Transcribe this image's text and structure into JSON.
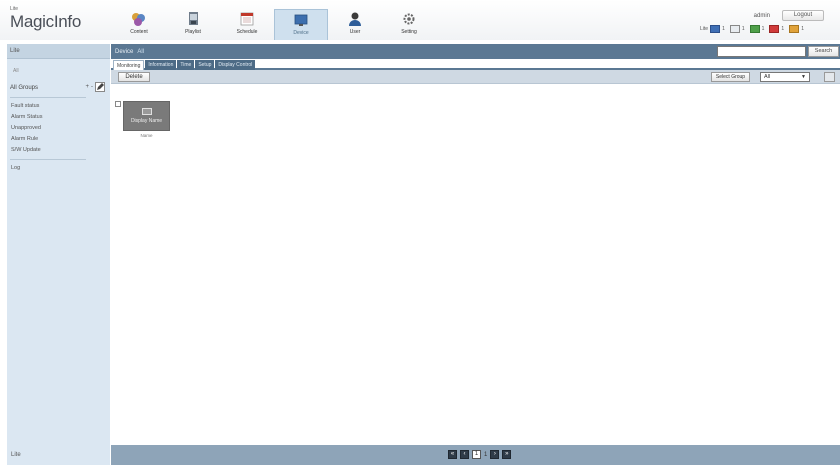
{
  "app": {
    "logo_small": "Lite",
    "logo": "MagicInfo"
  },
  "menu": [
    {
      "label": "Content",
      "icon": "content-icon"
    },
    {
      "label": "Playlist",
      "icon": "playlist-icon"
    },
    {
      "label": "Schedule",
      "icon": "schedule-icon"
    },
    {
      "label": "Device",
      "icon": "device-icon",
      "active": true
    },
    {
      "label": "User",
      "icon": "user-icon"
    },
    {
      "label": "Setting",
      "icon": "setting-icon"
    }
  ],
  "user": {
    "name": "admin",
    "logout_label": "Logout"
  },
  "status": {
    "label": "Lite",
    "counts": [
      "1",
      "1",
      "1",
      "1",
      "1"
    ]
  },
  "sidebar": {
    "header": "Lite",
    "section_label": "All",
    "group_label": "All Groups",
    "group_tools": [
      "+",
      "-"
    ],
    "items": [
      "Fault status",
      "Alarm Status",
      "Unapproved",
      "Alarm Rule",
      "S/W Update",
      "Log"
    ],
    "footer": "Lite"
  },
  "main": {
    "title": "Device",
    "subtitle": "All",
    "search_placeholder": "",
    "search_label": "Search",
    "tabs": [
      "Monitoring",
      "Information",
      "Time",
      "Setup",
      "Display Control"
    ],
    "delete_label": "Delete",
    "select_group_label": "Select Group",
    "group_value": "All",
    "devices": [
      {
        "thumb_label": "Display Name",
        "name": "Name"
      }
    ],
    "pager": {
      "current": "1",
      "total": "1"
    }
  }
}
